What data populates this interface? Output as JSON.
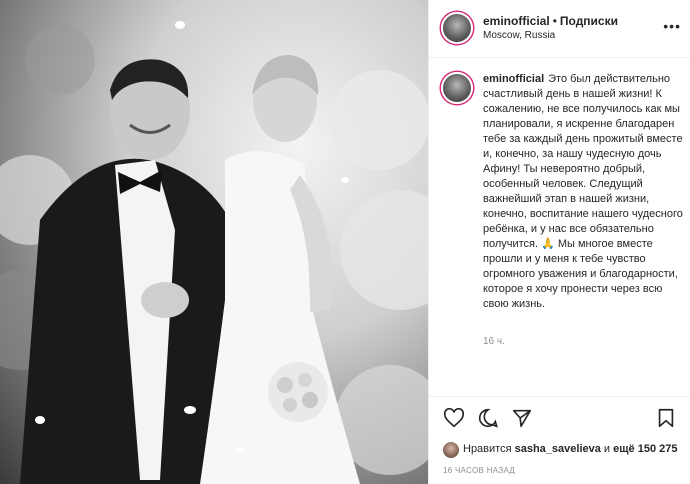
{
  "photo": {
    "alt_icon": "wedding-photo"
  },
  "header": {
    "username": "eminofficial",
    "dot": "•",
    "follow_label": "Подписки",
    "location": "Moscow, Russia",
    "more_icon": "more-horizontal-icon"
  },
  "caption": {
    "username": "eminofficial",
    "text": "Это был действительно счастливый день в нашей жизни! К сожалению, не все получилось как мы планировали, я искренне благодарен тебе за каждый день прожитый вместе и, конечно, за нашу чудесную дочь Афину! Ты невероятно добрый, особенный человек. Следущий важнейший этап в нашей жизни, конечно, воспитание нашего чудесного ребёнка, и у нас все обязательно получится. 🙏 Мы многое вместе прошли и у меня к тебе чувство огромного уважения и благодарности, которое я хочу пронести через всю свою жизнь.",
    "time": "16 ч."
  },
  "actions": {
    "like_icon": "heart-icon",
    "comment_icon": "comment-icon",
    "share_icon": "share-icon",
    "save_icon": "bookmark-icon"
  },
  "likes": {
    "prefix": "Нравится",
    "user": "sasha_savelieva",
    "middle": "и",
    "more": "ещё 150 275"
  },
  "posted": "16 ЧАСОВ НАЗАД",
  "colors": {
    "border": "#efefef",
    "text": "#262626",
    "muted": "#8e8e8e",
    "ring": "#d62976"
  }
}
